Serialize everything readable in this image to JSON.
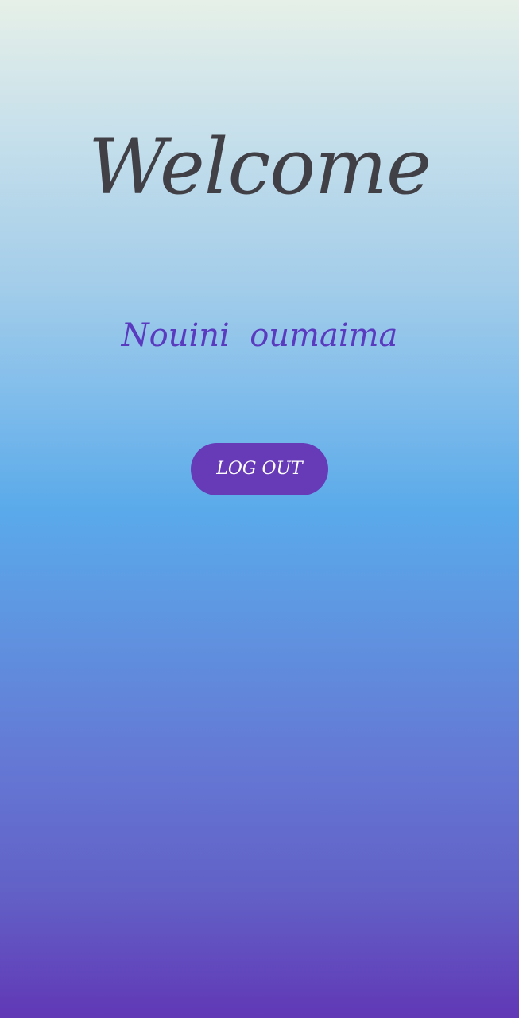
{
  "screen": {
    "title": "Welcome",
    "user_name": "Nouini  oumaima",
    "logout_label": "LOG OUT"
  },
  "colors": {
    "title_text": "#414046",
    "user_name_text": "#5a3bc0",
    "button_background": "#673ab7",
    "button_text": "#ffffff",
    "gradient_top": "#e6f0e8",
    "gradient_middle": "#5aaaea",
    "gradient_bottom": "#6138b6"
  }
}
